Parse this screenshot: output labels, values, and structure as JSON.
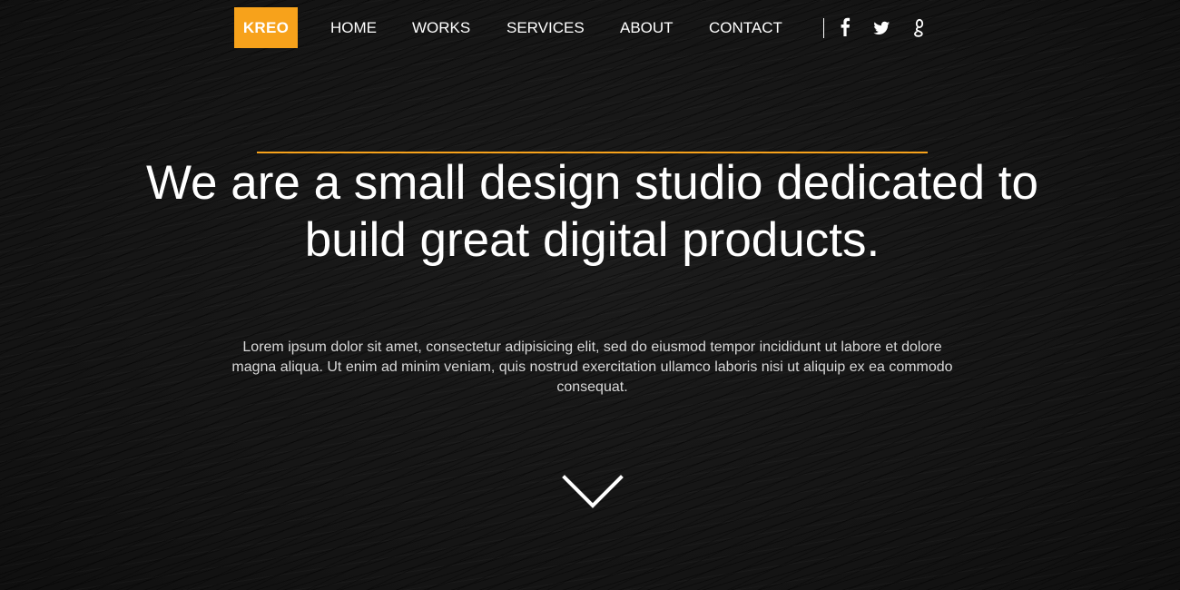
{
  "header": {
    "logo_text": "KREO",
    "nav_items": [
      "HOME",
      "WORKS",
      "SERVICES",
      "ABOUT",
      "CONTACT"
    ],
    "social_icons": [
      "facebook-icon",
      "twitter-icon",
      "google-plus-icon"
    ]
  },
  "hero": {
    "headline": "We are a small design studio dedicated to build great digital products.",
    "lead": "Lorem ipsum dolor sit amet, consectetur adipisicing elit, sed do eiusmod tempor incididunt ut labore et dolore magna aliqua. Ut enim ad minim veniam, quis nostrud exercitation ullamco laboris nisi ut aliquip ex ea commodo consequat.",
    "scroll_icon": "chevron-down-icon"
  },
  "colors": {
    "accent": "#f7a21b",
    "background": "#161616",
    "text": "#ffffff",
    "muted_text": "#d8d8d8"
  }
}
